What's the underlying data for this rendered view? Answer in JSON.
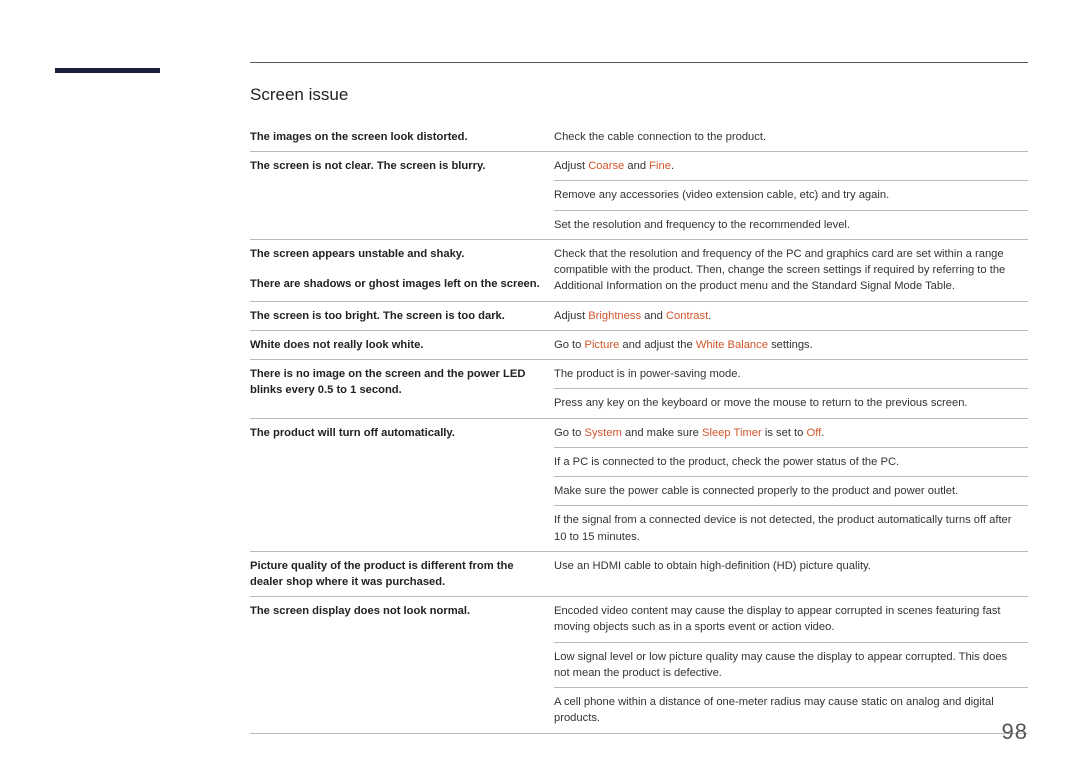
{
  "page_number": "98",
  "section_title": "Screen issue",
  "hl": {
    "coarse": "Coarse",
    "fine": "Fine",
    "brightness": "Brightness",
    "contrast": "Contrast",
    "picture": "Picture",
    "white_balance": "White Balance",
    "system": "System",
    "sleep_timer": "Sleep Timer",
    "off": "Off"
  },
  "rows": {
    "r1_left": "The images on the screen look distorted.",
    "r1_right": "Check the cable connection to the product.",
    "r2_left": "The screen is not clear. The screen is blurry.",
    "r2_right_a": "Adjust ",
    "r2_right_b": " and ",
    "r2_right_c": ".",
    "r3_right": "Remove any accessories (video extension cable, etc) and try again.",
    "r4_right": "Set the resolution and frequency to the recommended level.",
    "r5_left": "The screen appears unstable and shaky.",
    "r6_left": "There are shadows or ghost images left on the screen.",
    "r5_right": "Check that the resolution and frequency of the PC and graphics card are set within a range compatible with the product. Then, change the screen settings if required by referring to the Additional Information on the product menu and the Standard Signal Mode Table.",
    "r7_left": "The screen is too bright. The screen is too dark.",
    "r7_right_a": "Adjust ",
    "r7_right_b": " and ",
    "r7_right_c": ".",
    "r8_left": "White does not really look white.",
    "r8_right_a": "Go to ",
    "r8_right_b": " and adjust the ",
    "r8_right_c": " settings.",
    "r9_left": "There is no image on the screen and the power LED blinks every 0.5 to 1 second.",
    "r9_right": "The product is in power-saving mode.",
    "r10_right": "Press any key on the keyboard or move the mouse to return to the previous screen.",
    "r11_left": "The product will turn off automatically.",
    "r11_right_a": "Go to ",
    "r11_right_b": " and make sure ",
    "r11_right_c": " is set to ",
    "r11_right_d": ".",
    "r12_right": "If a PC is connected to the product, check the power status of the PC.",
    "r13_right": "Make sure the power cable is connected properly to the product and power outlet.",
    "r14_right": "If the signal from a connected device is not detected, the product automatically turns off after 10 to 15 minutes.",
    "r15_left": "Picture quality of the product is different from the dealer shop where it was purchased.",
    "r15_right": "Use an HDMI cable to obtain high-definition (HD) picture quality.",
    "r16_left": "The screen display does not look normal.",
    "r16_right": "Encoded video content may cause the display to appear corrupted in scenes featuring fast moving objects such as in a sports event or action video.",
    "r17_right": "Low signal level or low picture quality may cause the display to appear corrupted. This does not mean the product is defective.",
    "r18_right": "A cell phone within a distance of one-meter radius may cause static on analog and digital products."
  }
}
